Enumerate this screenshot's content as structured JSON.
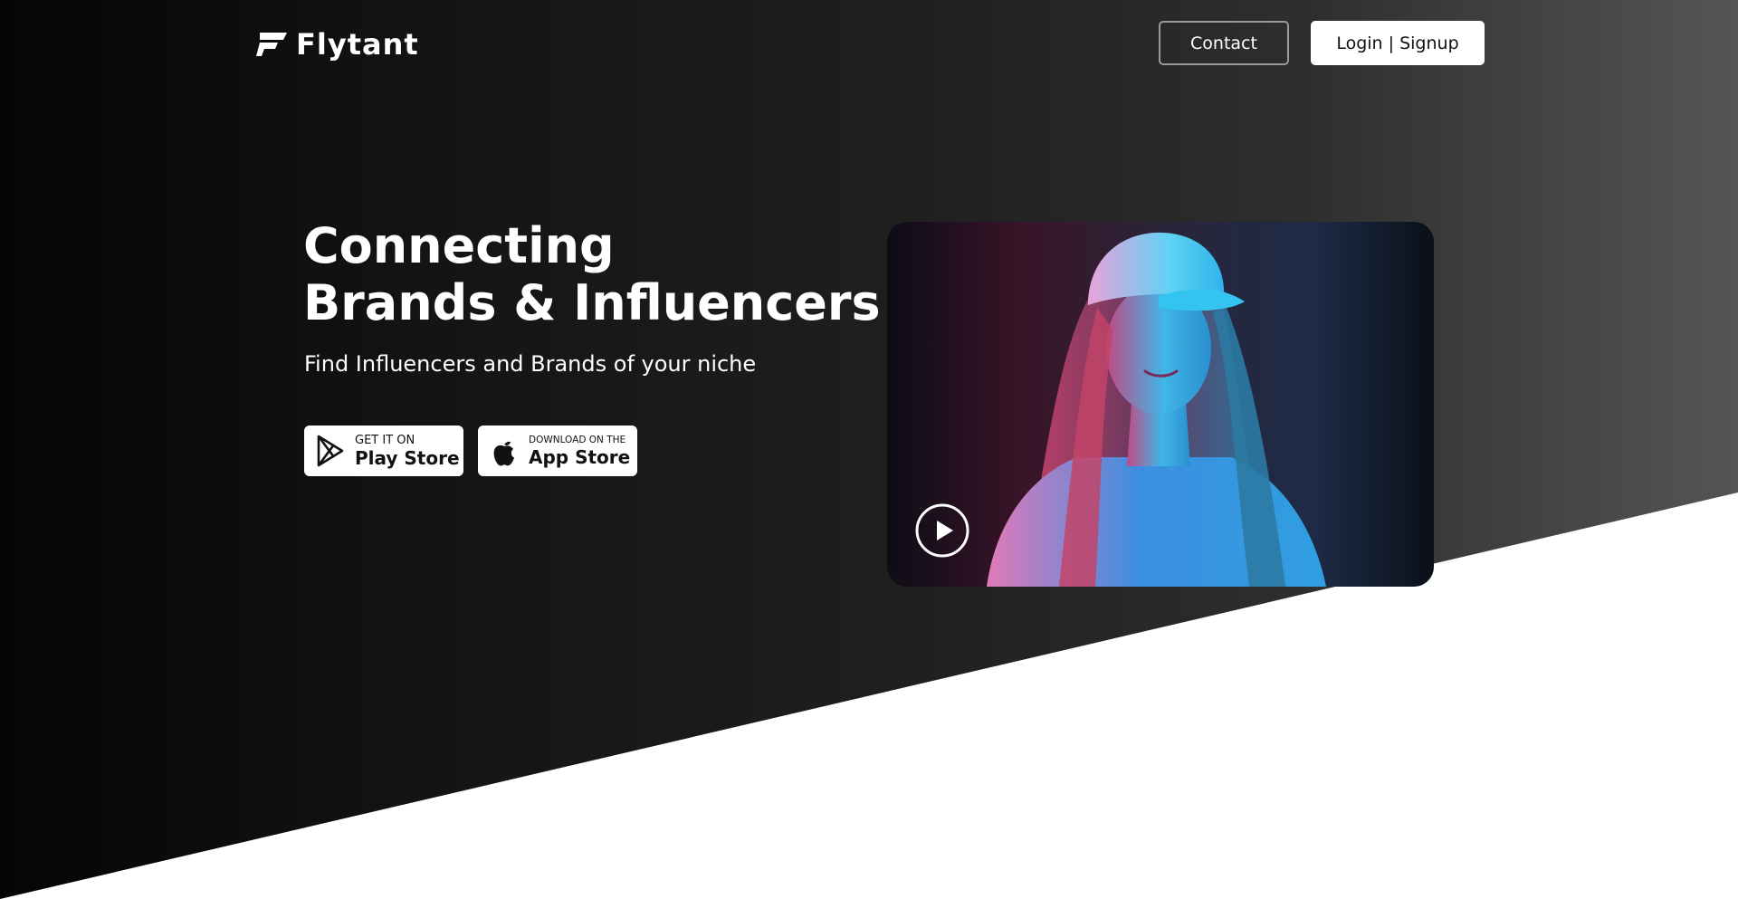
{
  "header": {
    "logo_text": "Flytant",
    "contact_label": "Contact",
    "login_label": "Login | Signup"
  },
  "hero": {
    "headline_line1": "Connecting",
    "headline_line2": "Brands & Influencers",
    "subtitle": "Find Influencers and Brands of your niche"
  },
  "store_buttons": {
    "play": {
      "small": "GET IT ON",
      "big": "Play Store",
      "icon": "google-play-icon"
    },
    "app": {
      "small": "DOWNLOAD ON THE",
      "big": "App Store",
      "icon": "apple-icon"
    }
  },
  "video": {
    "icon": "play-icon"
  },
  "colors": {
    "hero_dark": "#050505",
    "hero_light": "#555555",
    "button_white": "#ffffff",
    "contact_border": "#9a9a9a"
  }
}
